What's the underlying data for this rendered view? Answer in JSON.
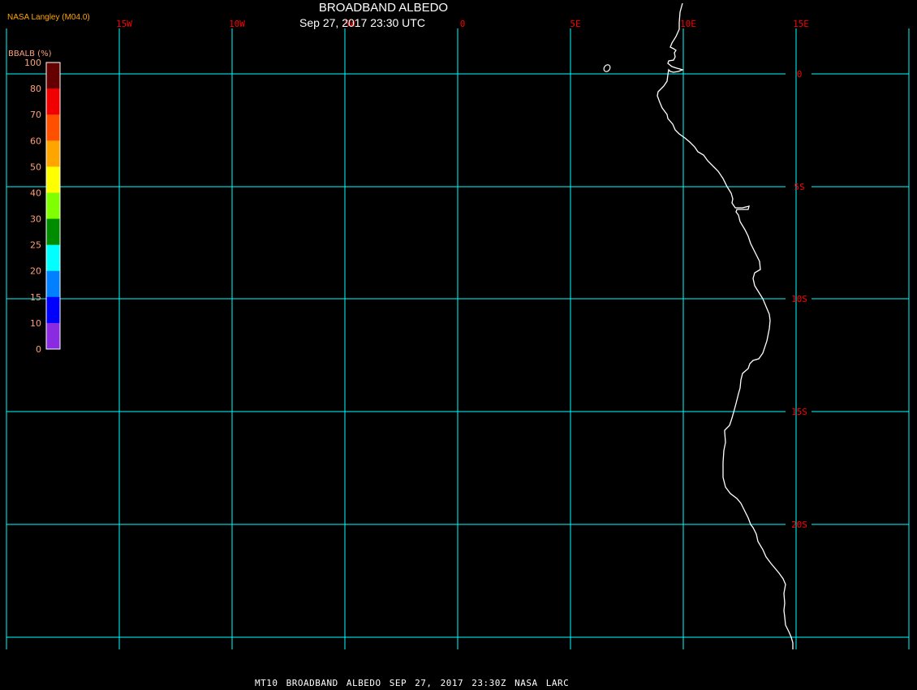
{
  "header": {
    "title": "BROADBAND ALBEDO",
    "subtitle": "Sep 27, 2017 23:30 UTC",
    "source": "NASA Langley (M04.0)"
  },
  "legend": {
    "title": "BBALB (%)",
    "labels": [
      "100",
      "80",
      "70",
      "60",
      "50",
      "40",
      "30",
      "25",
      "20",
      "15",
      "10",
      "0"
    ],
    "colors": [
      "#640000",
      "#f00000",
      "#ff5000",
      "#ffa500",
      "#ffff00",
      "#80ff00",
      "#008c00",
      "#00ffff",
      "#0080ff",
      "#0000ff",
      "#8a2be2"
    ]
  },
  "map": {
    "longitude_labels": [
      "15W",
      "10W",
      "5W",
      "0",
      "5E",
      "10E",
      "15E"
    ],
    "latitude_labels": [
      "0",
      "5S",
      "10S",
      "15S",
      "20S"
    ],
    "grid_color": "#00ffff",
    "label_color": "#ff0000",
    "coastline_color": "#ffffff"
  },
  "footer": "MT10  BROADBAND ALBEDO   SEP 27, 2017 23:30Z   NASA LARC"
}
